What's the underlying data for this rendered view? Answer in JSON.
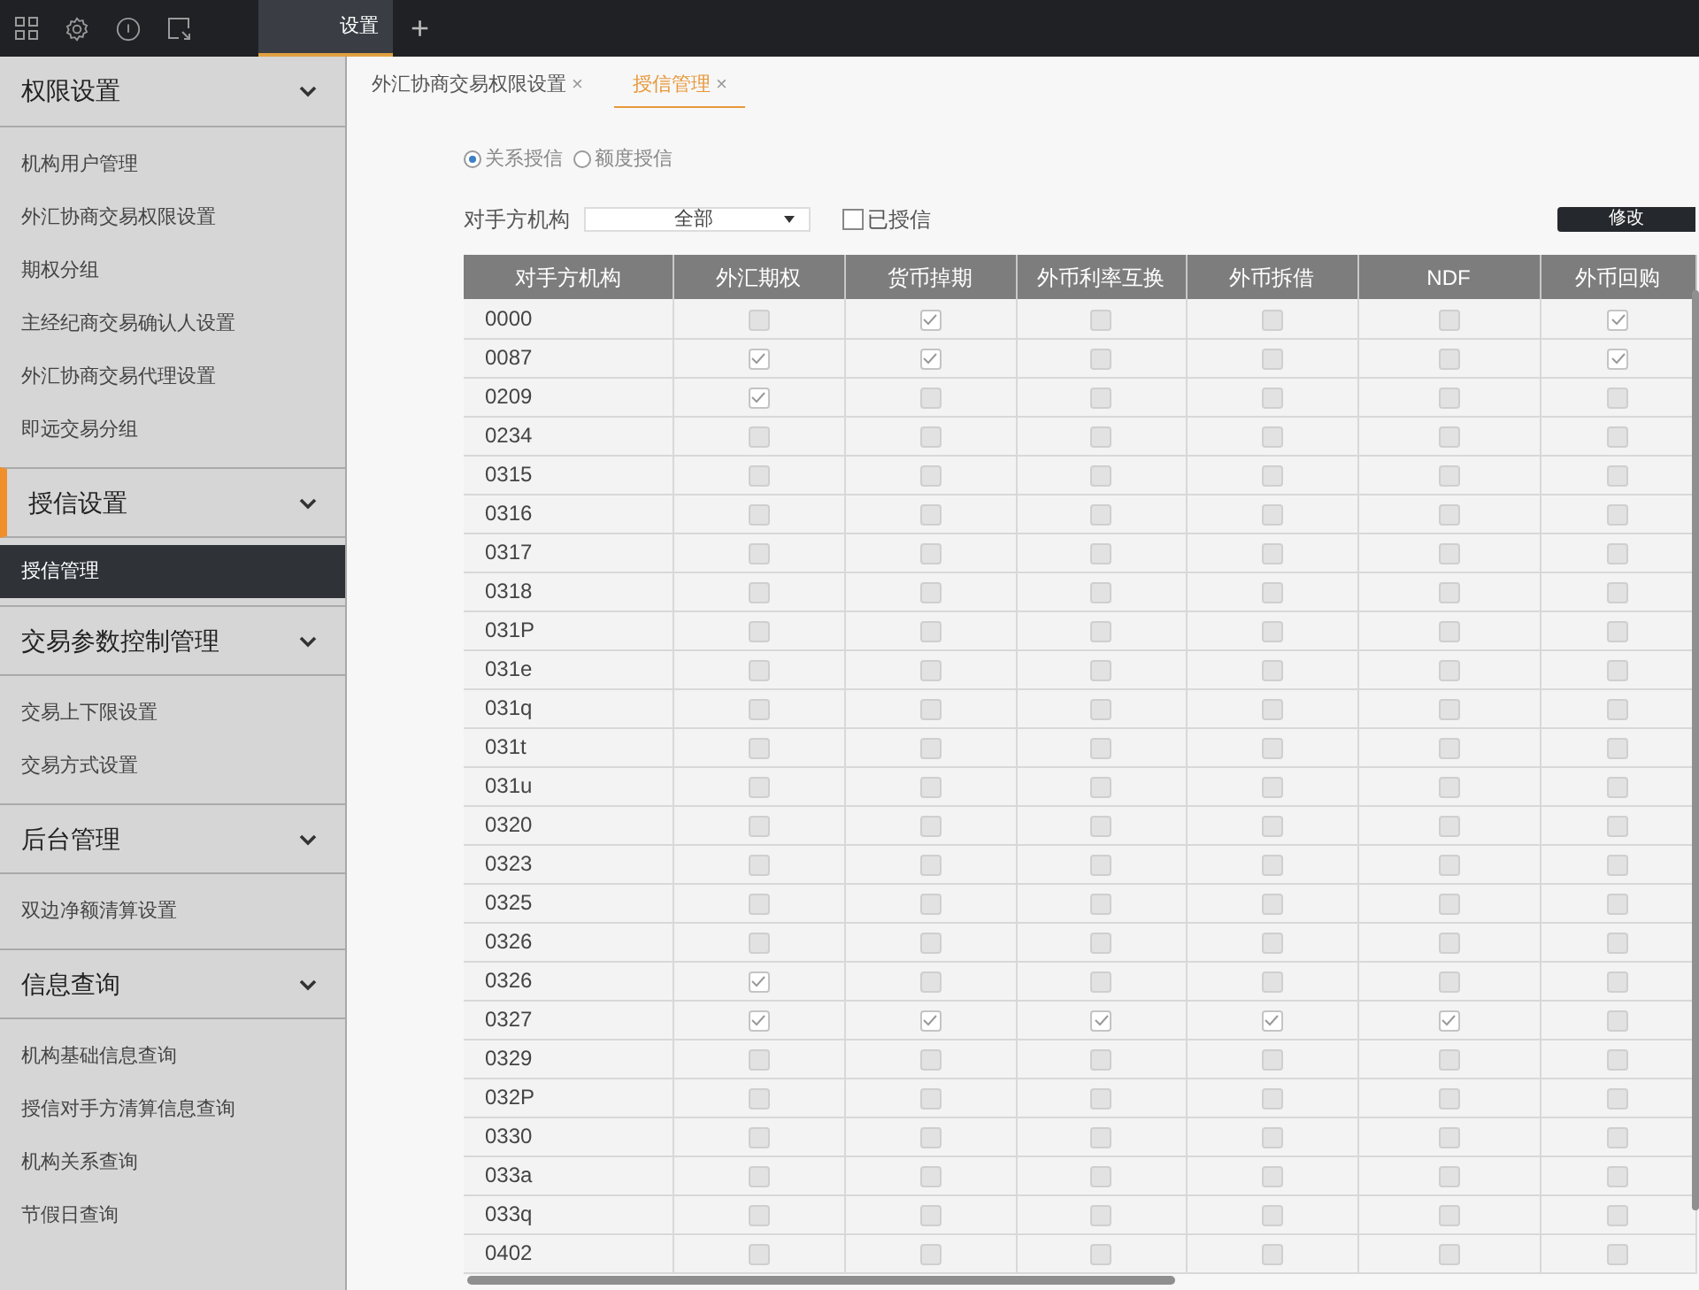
{
  "top_bar": {
    "tabs": [
      {
        "label": "设置",
        "selected": true
      }
    ],
    "add_tab": "+"
  },
  "sidebar": {
    "sections": [
      {
        "title": "权限设置",
        "expanded": true,
        "items": [
          {
            "label": "机构用户管理",
            "selected": false
          },
          {
            "label": "外汇协商交易权限设置",
            "selected": false
          },
          {
            "label": "期权分组",
            "selected": false
          },
          {
            "label": "主经纪商交易确认人设置",
            "selected": false
          },
          {
            "label": "外汇协商交易代理设置",
            "selected": false
          },
          {
            "label": "即远交易分组",
            "selected": false
          }
        ]
      },
      {
        "title": "授信设置",
        "expanded": true,
        "items": [
          {
            "label": "授信管理",
            "selected": true
          }
        ]
      },
      {
        "title": "交易参数控制管理",
        "expanded": true,
        "items": [
          {
            "label": "交易上下限设置",
            "selected": false
          },
          {
            "label": "交易方式设置",
            "selected": false
          }
        ]
      },
      {
        "title": "后台管理",
        "expanded": true,
        "items": [
          {
            "label": "双边净额清算设置",
            "selected": false
          }
        ]
      },
      {
        "title": "信息查询",
        "expanded": true,
        "items": [
          {
            "label": "机构基础信息查询",
            "selected": false
          },
          {
            "label": "授信对手方清算信息查询",
            "selected": false
          },
          {
            "label": "机构关系查询",
            "selected": false
          },
          {
            "label": "节假日查询",
            "selected": false
          }
        ]
      }
    ]
  },
  "content_tabs": [
    {
      "label": "外汇协商交易权限设置",
      "close": "×",
      "selected": false
    },
    {
      "label": "授信管理",
      "close": "×",
      "selected": true
    }
  ],
  "radio_options": [
    {
      "label": "关系授信",
      "selected": true
    },
    {
      "label": "额度授信",
      "selected": false
    }
  ],
  "filter": {
    "label": "对手方机构",
    "dropdown_value": "全部",
    "checkbox": {
      "label": "已授信",
      "checked": false
    },
    "button": "修改"
  },
  "table": {
    "columns": [
      "对手方机构",
      "外汇期权",
      "货币掉期",
      "外币利率互换",
      "外币拆借",
      "NDF",
      "外币回购"
    ],
    "rows": [
      {
        "institution": "0000",
        "checks": [
          false,
          true,
          false,
          false,
          false,
          true
        ]
      },
      {
        "institution": "0087",
        "checks": [
          true,
          true,
          false,
          false,
          false,
          true
        ]
      },
      {
        "institution": "0209",
        "checks": [
          true,
          false,
          false,
          false,
          false,
          false
        ]
      },
      {
        "institution": "0234",
        "checks": [
          false,
          false,
          false,
          false,
          false,
          false
        ]
      },
      {
        "institution": "0315",
        "checks": [
          false,
          false,
          false,
          false,
          false,
          false
        ]
      },
      {
        "institution": "0316",
        "checks": [
          false,
          false,
          false,
          false,
          false,
          false
        ]
      },
      {
        "institution": "0317",
        "checks": [
          false,
          false,
          false,
          false,
          false,
          false
        ]
      },
      {
        "institution": "0318",
        "checks": [
          false,
          false,
          false,
          false,
          false,
          false
        ]
      },
      {
        "institution": "031P",
        "checks": [
          false,
          false,
          false,
          false,
          false,
          false
        ]
      },
      {
        "institution": "031e",
        "checks": [
          false,
          false,
          false,
          false,
          false,
          false
        ]
      },
      {
        "institution": "031q",
        "checks": [
          false,
          false,
          false,
          false,
          false,
          false
        ]
      },
      {
        "institution": "031t",
        "checks": [
          false,
          false,
          false,
          false,
          false,
          false
        ]
      },
      {
        "institution": "031u",
        "checks": [
          false,
          false,
          false,
          false,
          false,
          false
        ]
      },
      {
        "institution": "0320",
        "checks": [
          false,
          false,
          false,
          false,
          false,
          false
        ]
      },
      {
        "institution": "0323",
        "checks": [
          false,
          false,
          false,
          false,
          false,
          false
        ]
      },
      {
        "institution": "0325",
        "checks": [
          false,
          false,
          false,
          false,
          false,
          false
        ]
      },
      {
        "institution": "0326",
        "checks": [
          false,
          false,
          false,
          false,
          false,
          false
        ]
      },
      {
        "institution": "0326",
        "checks": [
          true,
          false,
          false,
          false,
          false,
          false
        ]
      },
      {
        "institution": "0327",
        "checks": [
          true,
          true,
          true,
          true,
          true,
          false
        ]
      },
      {
        "institution": "0329",
        "checks": [
          false,
          false,
          false,
          false,
          false,
          false
        ]
      },
      {
        "institution": "032P",
        "checks": [
          false,
          false,
          false,
          false,
          false,
          false
        ]
      },
      {
        "institution": "0330",
        "checks": [
          false,
          false,
          false,
          false,
          false,
          false
        ]
      },
      {
        "institution": "033a",
        "checks": [
          false,
          false,
          false,
          false,
          false,
          false
        ]
      },
      {
        "institution": "033q",
        "checks": [
          false,
          false,
          false,
          false,
          false,
          false
        ]
      },
      {
        "institution": "0402",
        "checks": [
          false,
          false,
          false,
          false,
          false,
          false
        ]
      }
    ]
  }
}
